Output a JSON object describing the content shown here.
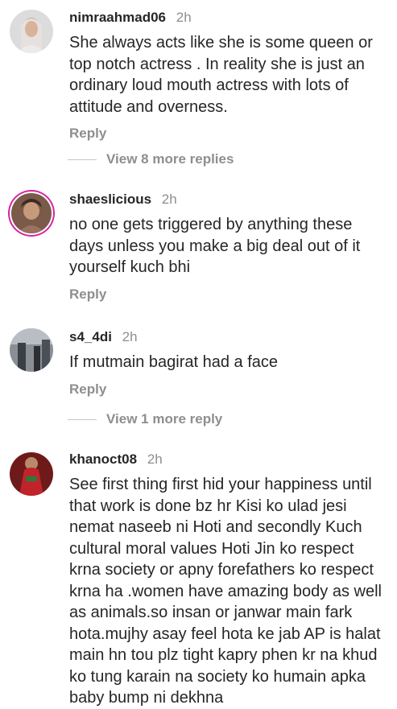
{
  "comments": [
    {
      "username": "nimraahmad06",
      "time": "2h",
      "text": "She always acts like she is some queen or top notch actress . In reality she is just an ordinary loud mouth actress with lots of attitude and overness.",
      "reply": "Reply",
      "view_more": "View 8 more replies"
    },
    {
      "username": "shaeslicious",
      "time": "2h",
      "text": "no one gets triggered by anything these days unless you make a big deal out of it yourself  kuch bhi",
      "reply": "Reply"
    },
    {
      "username": "s4_4di",
      "time": "2h",
      "text": "If mutmain bagirat had a face",
      "reply": "Reply",
      "view_more": "View 1 more reply"
    },
    {
      "username": "khanoct08",
      "time": "2h",
      "text": "See first thing first hid your happiness until that work is done bz hr Kisi ko ulad jesi nemat naseeb ni Hoti and secondly Kuch cultural moral values Hoti Jin ko respect krna society or apny forefathers ko respect krna ha .women have amazing body as well as animals.so insan or janwar main fark hota.mujhy asay feel hota ke jab AP is halat main hn tou plz tight kapry phen kr na khud ko tung karain na society ko humain apka baby bump ni dekhna"
    }
  ]
}
